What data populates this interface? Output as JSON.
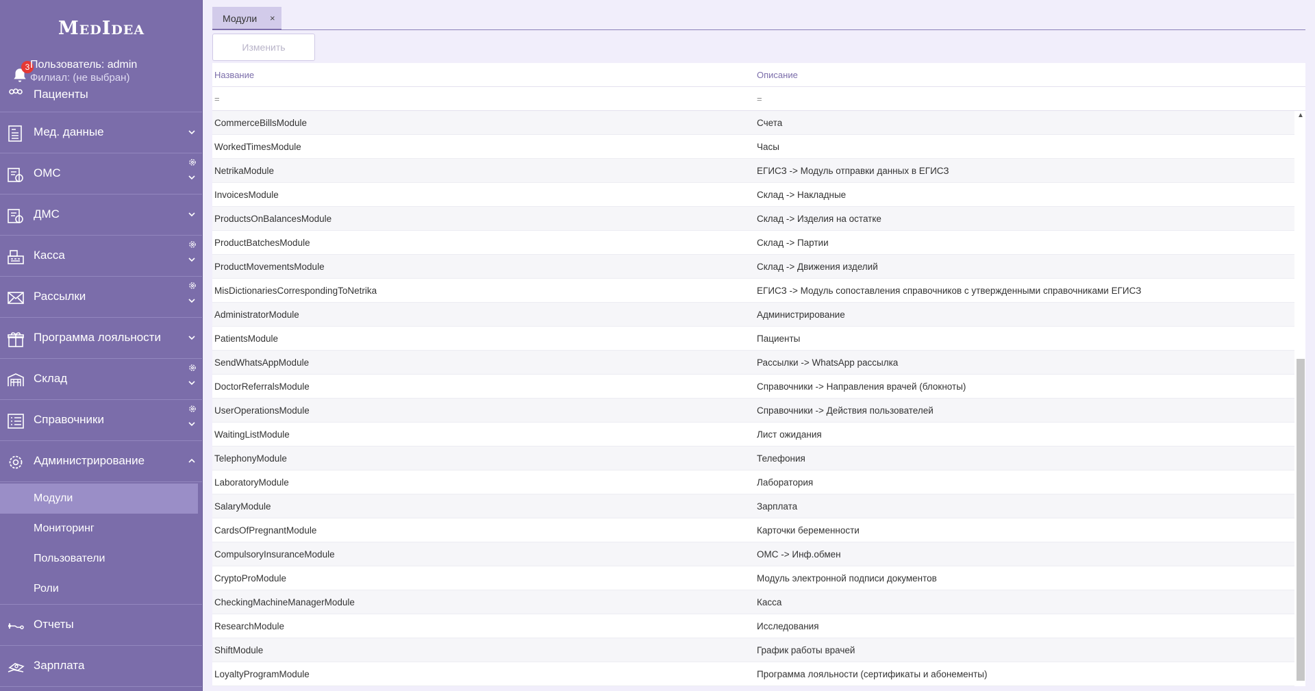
{
  "app": {
    "logo": "MedIdea",
    "user": "Пользователь: admin",
    "branch": "Филиал: (не выбран)",
    "notifications": "3"
  },
  "sidebar": {
    "patients": "Пациенты",
    "items": [
      {
        "label": "Мед. данные",
        "icon": "medical-record-icon"
      },
      {
        "label": "ОМС",
        "icon": "insurance-icon"
      },
      {
        "label": "ДМС",
        "icon": "insurance-icon"
      },
      {
        "label": "Касса",
        "icon": "cash-register-icon"
      },
      {
        "label": "Рассылки",
        "icon": "envelope-icon"
      },
      {
        "label": "Программа лояльности",
        "icon": "gift-icon"
      },
      {
        "label": "Склад",
        "icon": "warehouse-icon"
      },
      {
        "label": "Справочники",
        "icon": "list-icon"
      },
      {
        "label": "Администрирование",
        "icon": "gear-icon"
      }
    ],
    "admin_sub": [
      "Модули",
      "Мониторинг",
      "Пользователи",
      "Роли"
    ],
    "bottom": [
      {
        "label": "Отчеты",
        "icon": "reports-icon"
      },
      {
        "label": "Зарплата",
        "icon": "money-icon"
      }
    ]
  },
  "tabs": [
    {
      "label": "Модули",
      "close": "×"
    }
  ],
  "toolbar": {
    "edit_label": "Изменить"
  },
  "grid": {
    "columns": [
      "Название",
      "Описание"
    ],
    "filter_sign": "=",
    "rows": [
      [
        "CommerceBillsModule",
        "Счета"
      ],
      [
        "WorkedTimesModule",
        "Часы"
      ],
      [
        "NetrikaModule",
        "ЕГИСЗ -> Модуль отправки данных в ЕГИСЗ"
      ],
      [
        "InvoicesModule",
        "Склад -> Накладные"
      ],
      [
        "ProductsOnBalancesModule",
        "Склад -> Изделия на остатке"
      ],
      [
        "ProductBatchesModule",
        "Склад -> Партии"
      ],
      [
        "ProductMovementsModule",
        "Склад -> Движения изделий"
      ],
      [
        "MisDictionariesCorrespondingToNetrika",
        "ЕГИСЗ -> Модуль сопоставления справочников с утвержденными справочниками ЕГИСЗ"
      ],
      [
        "AdministratorModule",
        "Администрирование"
      ],
      [
        "PatientsModule",
        "Пациенты"
      ],
      [
        "SendWhatsAppModule",
        "Рассылки -> WhatsApp рассылка"
      ],
      [
        "DoctorReferralsModule",
        "Справочники -> Направления врачей (блокноты)"
      ],
      [
        "UserOperationsModule",
        "Справочники -> Действия пользователей"
      ],
      [
        "WaitingListModule",
        "Лист ожидания"
      ],
      [
        "TelephonyModule",
        "Телефония"
      ],
      [
        "LaboratoryModule",
        "Лаборатория"
      ],
      [
        "SalaryModule",
        "Зарплата"
      ],
      [
        "CardsOfPregnantModule",
        "Карточки беременности"
      ],
      [
        "CompulsoryInsuranceModule",
        "ОМС -> Инф.обмен"
      ],
      [
        "CryptoProModule",
        "Модуль электронной подписи документов"
      ],
      [
        "CheckingMachineManagerModule",
        "Касса"
      ],
      [
        "ResearchModule",
        "Исследования"
      ],
      [
        "ShiftModule",
        "График работы врачей"
      ],
      [
        "LoyaltyProgramModule",
        "Программа лояльности (сертификаты и абонементы)"
      ]
    ]
  }
}
